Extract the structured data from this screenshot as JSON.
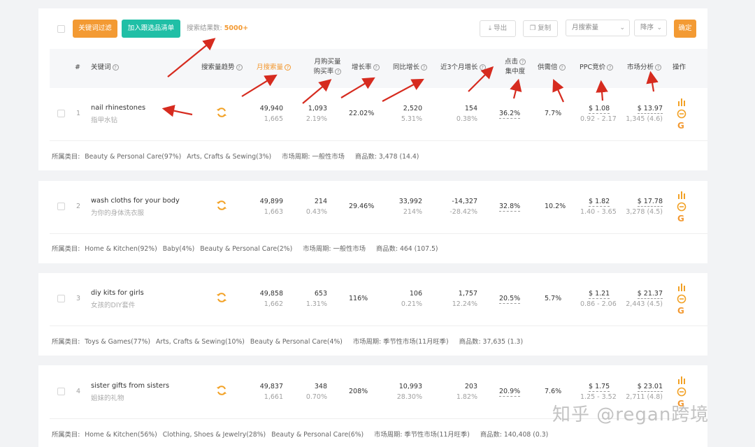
{
  "toolbar": {
    "btn_keyword_filter": "关键词过滤",
    "btn_add_to_list": "加入跟选品清单",
    "result_label": "搜索结果数:",
    "result_count": "5000+",
    "btn_export": "导出",
    "btn_copy": "复制",
    "sort_field": "月搜索量",
    "sort_order": "降序",
    "btn_confirm": "确定"
  },
  "header": {
    "index": "#",
    "keyword": "关键词",
    "search_trend": "搜索量趋势",
    "monthly_search": "月搜索量",
    "monthly_purchase_1": "月购买量",
    "monthly_purchase_2": "购买率",
    "growth": "增长率",
    "yoy": "同比增长",
    "last3": "近3个月增长",
    "click_1": "点击",
    "click_2": "集中度",
    "supply_demand": "供需倍",
    "ppc": "PPC竞价",
    "market": "市场分析",
    "ops": "操作"
  },
  "rows": [
    {
      "index": "1",
      "keyword": "nail rhinestones",
      "keyword_zh": "指甲水钻",
      "search": "49,940",
      "search_sub": "1,665",
      "purchase": "1,093",
      "purchase_rate": "2.19%",
      "growth": "22.02%",
      "yoy": "2,520",
      "yoy_sub": "5.31%",
      "last3": "154",
      "last3_sub": "0.38%",
      "click": "36.2%",
      "supply": "7.7%",
      "ppc": "$ 1.08",
      "ppc_range": "0.92 - 2.17",
      "market": "$ 13.97",
      "market_sub": "1,345 (4.6)",
      "cat_label": "所属类目:",
      "cats": [
        "Beauty & Personal Care(97%)",
        "Arts, Crafts & Sewing(3%)"
      ],
      "cycle": "市场周期: 一般性市场",
      "goods": "商品数: 3,478 (14.4)"
    },
    {
      "index": "2",
      "keyword": "wash cloths for your body",
      "keyword_zh": "为你的身体洗衣服",
      "search": "49,899",
      "search_sub": "1,663",
      "purchase": "214",
      "purchase_rate": "0.43%",
      "growth": "29.46%",
      "yoy": "33,992",
      "yoy_sub": "214%",
      "last3": "-14,327",
      "last3_sub": "-28.42%",
      "click": "32.8%",
      "supply": "10.2%",
      "ppc": "$ 1.82",
      "ppc_range": "1.40 - 3.65",
      "market": "$ 17.78",
      "market_sub": "3,278 (4.5)",
      "cat_label": "所属类目:",
      "cats": [
        "Home & Kitchen(92%)",
        "Baby(4%)",
        "Beauty & Personal Care(2%)"
      ],
      "cycle": "市场周期: 一般性市场",
      "goods": "商品数: 464 (107.5)"
    },
    {
      "index": "3",
      "keyword": "diy kits for girls",
      "keyword_zh": "女孩的DIY套件",
      "search": "49,858",
      "search_sub": "1,662",
      "purchase": "653",
      "purchase_rate": "1.31%",
      "growth": "116%",
      "yoy": "106",
      "yoy_sub": "0.21%",
      "last3": "1,757",
      "last3_sub": "12.24%",
      "click": "20.5%",
      "supply": "5.7%",
      "ppc": "$ 1.21",
      "ppc_range": "0.86 - 2.06",
      "market": "$ 21.37",
      "market_sub": "2,443 (4.5)",
      "cat_label": "所属类目:",
      "cats": [
        "Toys & Games(77%)",
        "Arts, Crafts & Sewing(10%)",
        "Beauty & Personal Care(4%)"
      ],
      "cycle": "市场周期: 季节性市场(11月旺季)",
      "goods": "商品数: 37,635 (1.3)"
    },
    {
      "index": "4",
      "keyword": "sister gifts from sisters",
      "keyword_zh": "姐妹的礼物",
      "search": "49,837",
      "search_sub": "1,661",
      "purchase": "348",
      "purchase_rate": "0.70%",
      "growth": "208%",
      "yoy": "10,993",
      "yoy_sub": "28.30%",
      "last3": "203",
      "last3_sub": "1.82%",
      "click": "20.9%",
      "supply": "7.6%",
      "ppc": "$ 1.75",
      "ppc_range": "1.25 - 3.52",
      "market": "$ 23.01",
      "market_sub": "2,711 (4.8)",
      "cat_label": "所属类目:",
      "cats": [
        "Home & Kitchen(56%)",
        "Clothing, Shoes & Jewelry(28%)",
        "Beauty & Personal Care(6%)"
      ],
      "cycle": "市场周期: 季节性市场(11月旺季)",
      "goods": "商品数: 140,408 (0.3)"
    }
  ],
  "watermark": "知乎 @regan跨境",
  "colors": {
    "orange": "#f39a33",
    "teal": "#20bfa6",
    "arrow_red": "#d62b1f",
    "trend_orange": "#f2a125",
    "google_orange": "#f39a33"
  }
}
